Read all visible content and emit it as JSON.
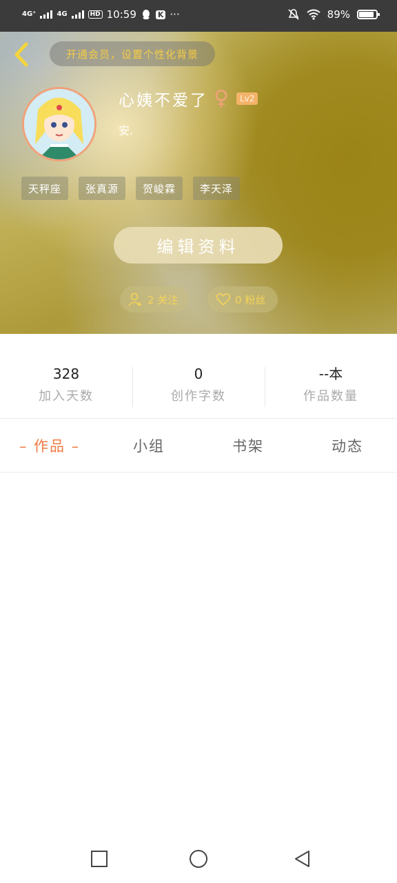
{
  "status_bar": {
    "signal1": "4G⁺",
    "signal2": "4G",
    "hd": "HD",
    "time": "10:59",
    "k_label": "K",
    "more": "···",
    "battery": "89%"
  },
  "header": {
    "vip_text": "开通会员，设置个性化背景",
    "username": "心姨不爱了",
    "level": "Lv2",
    "signature": "安.",
    "tags": [
      "天秤座",
      "张真源",
      "贺峻霖",
      "李天泽"
    ],
    "edit_label": "编辑资料",
    "follow_text": "2 关注",
    "fans_text": "0 粉丝"
  },
  "stats": [
    {
      "value": "328",
      "label": "加入天数"
    },
    {
      "value": "0",
      "label": "创作字数"
    },
    {
      "value": "--本",
      "label": "作品数量"
    }
  ],
  "tabs": [
    "– 作品 –",
    "小组",
    "书架",
    "动态"
  ],
  "colors": {
    "accent": "#ef7a43",
    "vip_text": "#f4cc45",
    "female": "#f0a27a"
  }
}
